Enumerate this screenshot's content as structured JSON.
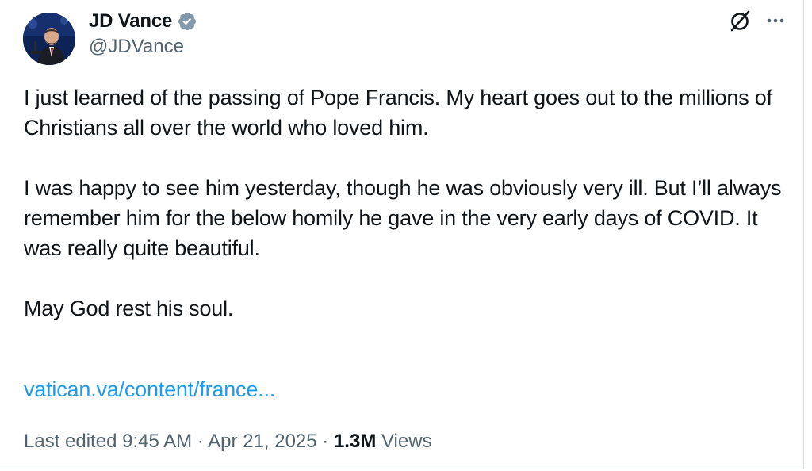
{
  "author": {
    "display_name": "JD Vance",
    "handle": "@JDVance",
    "verified": true
  },
  "icons": {
    "verified": "verified-badge-icon",
    "grok": "grok-icon",
    "more": "more-options-icon"
  },
  "colors": {
    "text_primary": "#0f1419",
    "text_secondary": "#536471",
    "link": "#1d9bf0",
    "verified_badge": "#829aab"
  },
  "tweet": {
    "paragraphs": [
      "I just learned of the passing of Pope Francis. My heart goes out to the millions of Christians all over the world who loved him.",
      "I was happy to see him yesterday, though he was obviously very ill. But I’ll always remember him for the below homily he gave in the very early days of COVID. It was really quite beautiful.",
      "May God rest his soul."
    ],
    "link_text": "vatican.va/content/france..."
  },
  "meta": {
    "edited_label": "Last edited",
    "time": "9:45 AM",
    "separator": "·",
    "date": "Apr 21, 2025",
    "views_count": "1.3M",
    "views_label": "Views"
  }
}
